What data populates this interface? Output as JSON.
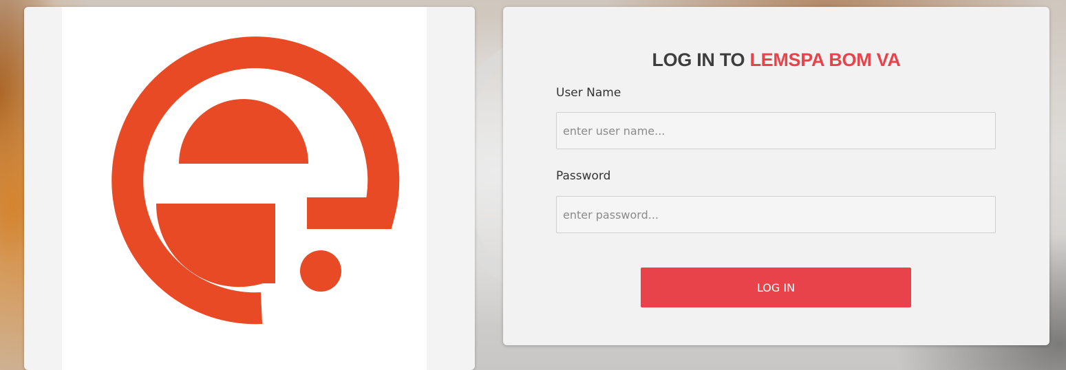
{
  "brand": {
    "logo_name": "e-logo",
    "accent_color": "#e84a26"
  },
  "login": {
    "title_prefix": "LOG IN TO ",
    "title_brand": "LEMSPA BOM VA",
    "title_brand_color": "#e8434a",
    "username_label": "User Name",
    "username_placeholder": "enter user name...",
    "username_value": "",
    "password_label": "Password",
    "password_placeholder": "enter password...",
    "password_value": "",
    "submit_label": "LOG IN",
    "submit_color": "#e8434a"
  }
}
